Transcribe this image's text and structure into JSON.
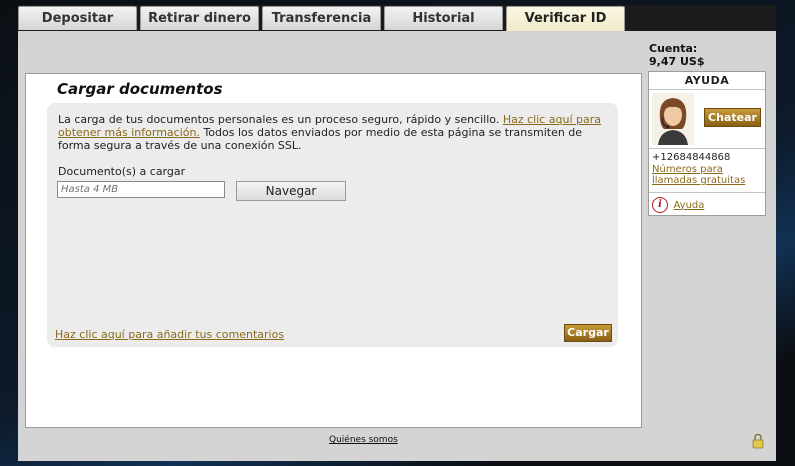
{
  "tabs": [
    {
      "label": "Depositar",
      "active": false
    },
    {
      "label": "Retirar dinero",
      "active": false
    },
    {
      "label": "Transferencia",
      "active": false
    },
    {
      "label": "Historial",
      "active": false
    },
    {
      "label": "Verificar ID",
      "active": true
    }
  ],
  "main": {
    "heading": "Cargar documentos",
    "intro_text": "La carga de tus documentos personales es un proceso seguro, rápido y sencillo.",
    "intro_link": "Haz clic aquí para obtener más información.",
    "intro_text_2": "Todos los datos enviados por medio de esta página se transmiten de forma segura a través de una conexión SSL.",
    "documents_label": "Documento(s) a cargar",
    "file_placeholder": "Hasta 4 MB",
    "browse_label": "Navegar",
    "comment_link": "Haz clic aquí para añadir tus comentarios",
    "upload_label": "Cargar"
  },
  "account": {
    "label": "Cuenta:",
    "balance": "9,47 US$"
  },
  "help": {
    "title": "AYUDA",
    "chat_label": "Chatear",
    "phone": "+12684844868",
    "free_numbers_link": "Números para llamadas gratuitas",
    "help_link": "Ayuda",
    "info_icon": "i"
  },
  "footer": {
    "about_link": "Quiénes somos"
  },
  "colors": {
    "accent_gold": "#8b6a1a",
    "button_gold": "#a67a25",
    "tab_active": "#f1ebc9"
  }
}
